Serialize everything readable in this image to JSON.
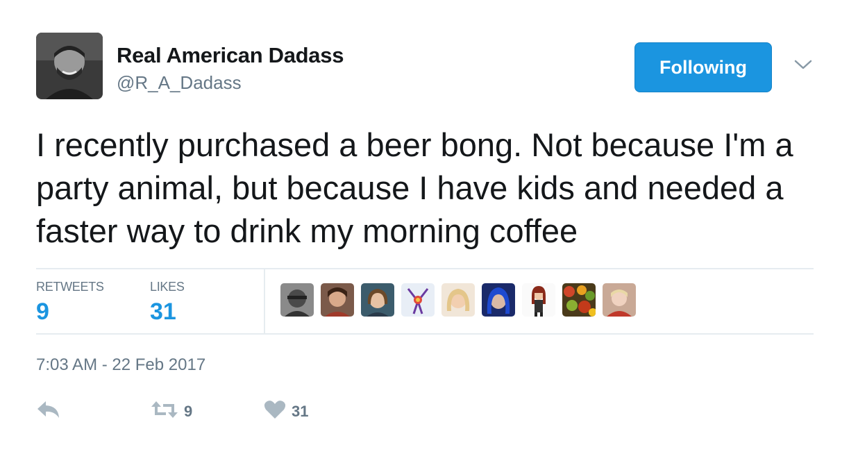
{
  "tweet": {
    "author_name": "Real American Dadass",
    "author_handle": "@R_A_Dadass",
    "follow_label": "Following",
    "text": "I recently purchased a beer bong. Not because I'm a party animal, but because I have kids and needed a faster way to drink my morning coffee",
    "retweets_label": "RETWEETS",
    "retweets_count": "9",
    "likes_label": "LIKES",
    "likes_count": "31",
    "timestamp": "7:03 AM - 22 Feb 2017",
    "action_retweet_count": "9",
    "action_like_count": "31"
  },
  "colors": {
    "accent": "#1b95e0",
    "muted": "#657786",
    "text": "#14171a",
    "border": "#e6ecf0"
  },
  "icons": [
    "chevron-down-icon",
    "reply-icon",
    "retweet-icon",
    "heart-icon"
  ],
  "liker_avatars": [
    "liker-1",
    "liker-2",
    "liker-3",
    "liker-4",
    "liker-5",
    "liker-6",
    "liker-7",
    "liker-8",
    "liker-9"
  ]
}
